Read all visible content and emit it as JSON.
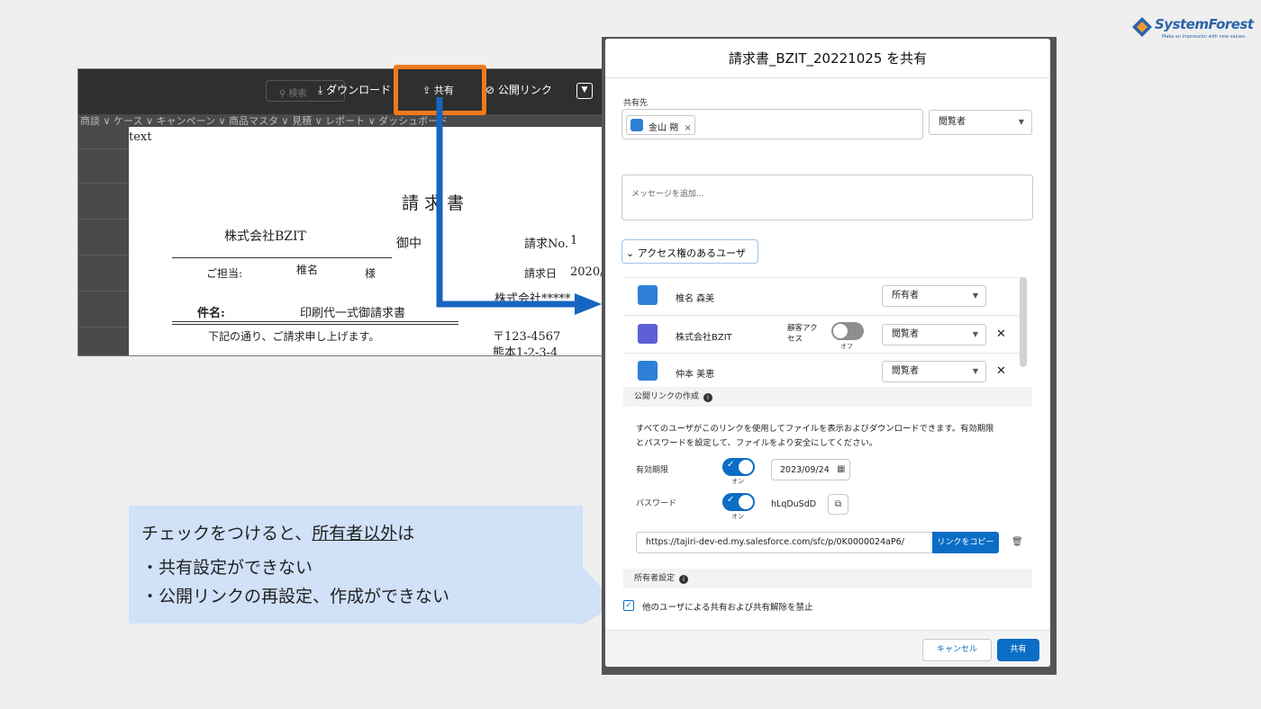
{
  "brand": {
    "name": "SystemForest",
    "tagline": "Make an impression with new values."
  },
  "background": {
    "toolbar": {
      "search": "検索",
      "download": "ダウンロード",
      "share": "共有",
      "public_link": "公開リンク"
    },
    "menu": "商談 ∨  ケース ∨  キャンペーン ∨  商品マスタ ∨  見積 ∨  レポート ∨  ダッシュボード",
    "doc": {
      "text_tag": "text",
      "title": "請 求 書",
      "company": "株式会社BZIT",
      "onchu": "御中",
      "invoice_no_label": "請求No.",
      "invoice_no": "1",
      "contact_label": "ご担当:",
      "contact_name": "椎名",
      "sama": "様",
      "date_label": "請求日",
      "date_value": "2020/",
      "subject_label": "件名:",
      "subject_value": "印刷代一式御請求書",
      "sender": "株式会社*****",
      "note": "下記の通り、ご請求申し上げます。",
      "postal": "〒123-4567",
      "address": "熊本1-2-3-4"
    }
  },
  "callout": {
    "line1_pre": "チェックをつけると、",
    "line1_em": "所有者以外",
    "line1_post": "は",
    "line2": "・共有設定ができない",
    "line3": "・公開リンクの再設定、作成ができない"
  },
  "dialog": {
    "title": "請求書_BZIT_20221025 を共有",
    "share_to_label": "共有先",
    "recipient": "金山 朔",
    "recipient_remove": "×",
    "permission": "閲覧者",
    "message_placeholder": "メッセージを追加...",
    "access_toggle": "アクセス権のあるユーザ",
    "users": [
      {
        "name": "椎名 森美",
        "role": "所有者",
        "type": "user"
      },
      {
        "name": "株式会社BZIT",
        "role": "閲覧者",
        "type": "org",
        "customer_access_label": "顧客アクセス",
        "customer_access_state": "オフ"
      },
      {
        "name": "仲本 美恵",
        "role": "閲覧者",
        "type": "user"
      }
    ],
    "public_link": {
      "section_label": "公開リンクの作成",
      "description_1": "すべてのユーザがこのリンクを使用してファイルを表示およびダウンロードできます。有効期限",
      "description_2": "とパスワードを設定して、ファイルをより安全にしてください。",
      "expiry_label": "有効期限",
      "expiry_state": "オン",
      "expiry_date": "2023/09/24",
      "password_label": "パスワード",
      "password_state": "オン",
      "password_value": "hLqDuSdD",
      "url": "https://tajiri-dev-ed.my.salesforce.com/sfc/p/0K0000024aP6/",
      "copy_button": "リンクをコピー"
    },
    "owner_settings": {
      "section_label": "所有者設定",
      "checkbox_label": "他のユーザによる共有および共有解除を禁止",
      "checked": true
    },
    "cancel": "キャンセル",
    "share": "共有"
  },
  "colors": {
    "accent": "#0a6dc6",
    "highlight": "#ee7a1e",
    "callout_bg": "#d0e1f8",
    "arrow": "#1565c0"
  }
}
